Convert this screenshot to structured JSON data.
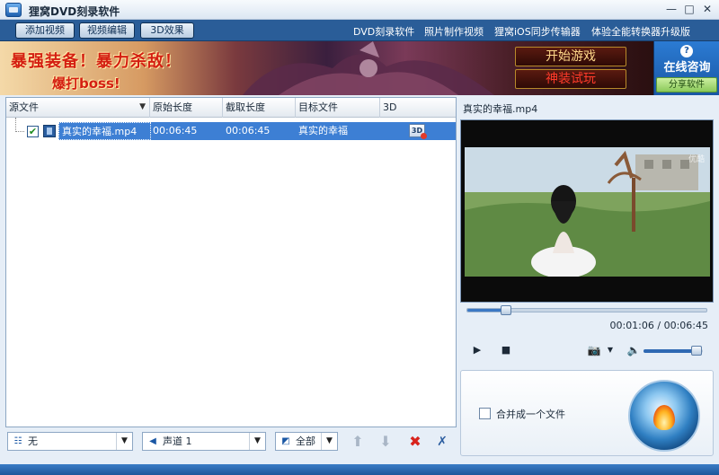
{
  "window": {
    "title": "狸窝DVD刻录软件",
    "minimize": "—",
    "maximize": "□",
    "close": "✕"
  },
  "toolbar": {
    "add_video": "添加视频",
    "video_edit": "视频编辑",
    "effect_3d": "3D效果",
    "links": [
      "DVD刻录软件",
      "照片制作视频",
      "狸窝iOS同步传输器",
      "体验全能转换器升级版"
    ]
  },
  "banner": {
    "line1": "暴强装备！暴力杀敌！",
    "line2": "爆打boss!",
    "start_game": "开始游戏",
    "try_equipment": "神装试玩"
  },
  "consult": {
    "icon": "?",
    "label": "在线咨询",
    "share": "分享软件"
  },
  "file_table": {
    "columns": [
      "源文件",
      "原始长度",
      "截取长度",
      "目标文件",
      "3D"
    ],
    "sort_indicator": "▼",
    "rows": [
      {
        "checked": "✔",
        "source": "真实的幸福.mp4",
        "original_length": "00:06:45",
        "cut_length": "00:06:45",
        "target": "真实的幸福",
        "threed": "3D"
      }
    ]
  },
  "bottom_controls": {
    "subtitle_value": "无",
    "audio_value": "声道 1",
    "scope_value": "全部",
    "up": "⬆",
    "down": "⬇",
    "delete": "✖",
    "clear": "✗"
  },
  "preview": {
    "title": "真实的幸福.mp4",
    "watermark": "优酷",
    "time_current": "00:01:06",
    "time_total": "00:06:45",
    "time_separator": " / ",
    "progress": 0.163,
    "volume": 0.9,
    "play": "▶",
    "stop": "■",
    "snapshot": "📷",
    "snapshot_arrow": "▼",
    "volume_icon": "🔈"
  },
  "burn": {
    "merge_label": "合并成一个文件"
  }
}
